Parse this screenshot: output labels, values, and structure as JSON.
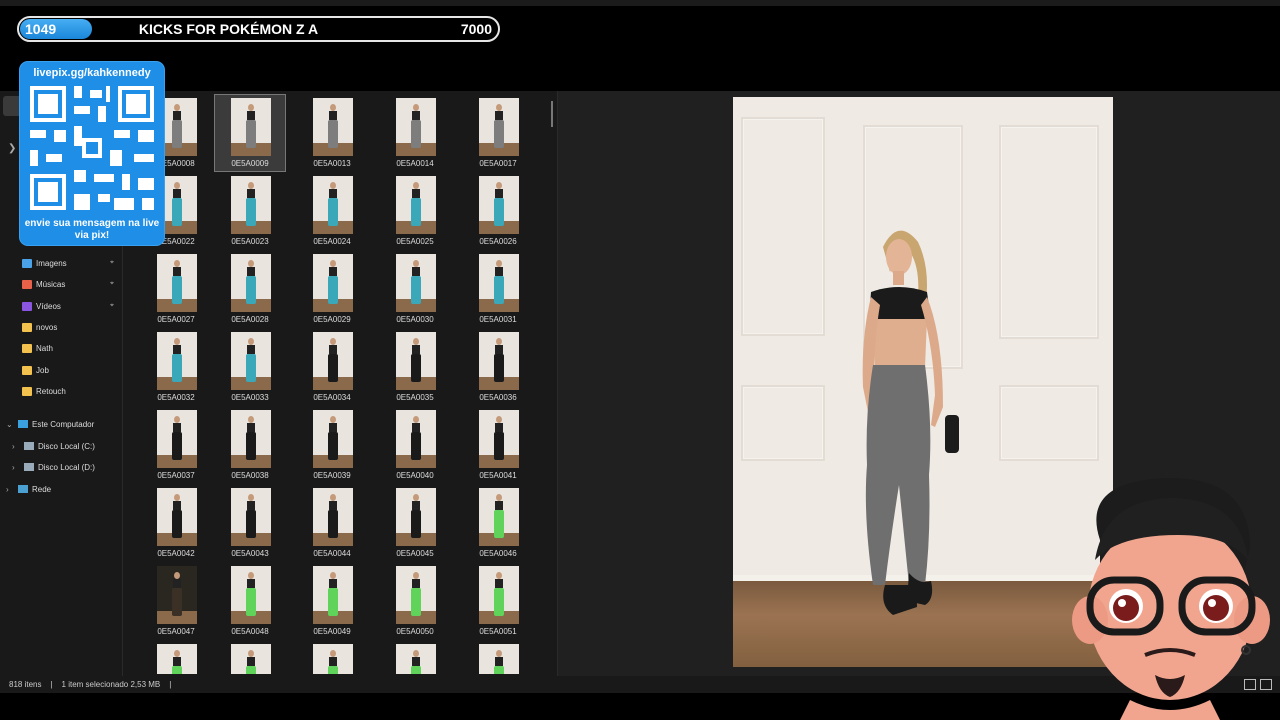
{
  "goal": {
    "current": "1049",
    "title": "KICKS FOR POKÉMON Z A",
    "target": "7000",
    "progress": 0.15
  },
  "qr": {
    "top_text": "livepix.gg/kahkennedy",
    "bottom_text": "envie sua mensagem na live via pix!"
  },
  "sidebar": {
    "items": [
      {
        "label": "Imagens",
        "icon": "images-icon",
        "pinned": true,
        "color": "#4aa3e8"
      },
      {
        "label": "Músicas",
        "icon": "music-icon",
        "pinned": true,
        "color": "#e8624a"
      },
      {
        "label": "Vídeos",
        "icon": "videos-icon",
        "pinned": true,
        "color": "#8a55e0"
      },
      {
        "label": "novos",
        "icon": "folder-icon",
        "pinned": false,
        "color": "#f2c14e"
      },
      {
        "label": "Nath",
        "icon": "folder-icon",
        "pinned": false,
        "color": "#f2c14e"
      },
      {
        "label": "Job",
        "icon": "folder-icon",
        "pinned": false,
        "color": "#f2c14e"
      },
      {
        "label": "Retouch",
        "icon": "folder-icon",
        "pinned": false,
        "color": "#f2c14e"
      }
    ],
    "tree": [
      {
        "label": "Este Computador",
        "icon": "computer-icon",
        "expanded": true
      },
      {
        "label": "Disco Local (C:)",
        "icon": "drive-icon",
        "expanded": false
      },
      {
        "label": "Disco Local (D:)",
        "icon": "drive-icon",
        "expanded": false
      },
      {
        "label": "Rede",
        "icon": "network-icon",
        "expanded": false
      }
    ]
  },
  "files": [
    {
      "name": "0E5A0008",
      "pants": "gray"
    },
    {
      "name": "0E5A0009",
      "pants": "gray",
      "selected": true
    },
    {
      "name": "0E5A0013",
      "pants": "gray"
    },
    {
      "name": "0E5A0014",
      "pants": "gray"
    },
    {
      "name": "0E5A0017",
      "pants": "gray"
    },
    {
      "name": "0E5A0022",
      "pants": "teal"
    },
    {
      "name": "0E5A0023",
      "pants": "teal"
    },
    {
      "name": "0E5A0024",
      "pants": "teal"
    },
    {
      "name": "0E5A0025",
      "pants": "teal"
    },
    {
      "name": "0E5A0026",
      "pants": "teal"
    },
    {
      "name": "0E5A0027",
      "pants": "teal"
    },
    {
      "name": "0E5A0028",
      "pants": "teal"
    },
    {
      "name": "0E5A0029",
      "pants": "teal"
    },
    {
      "name": "0E5A0030",
      "pants": "teal"
    },
    {
      "name": "0E5A0031",
      "pants": "teal"
    },
    {
      "name": "0E5A0032",
      "pants": "teal"
    },
    {
      "name": "0E5A0033",
      "pants": "teal"
    },
    {
      "name": "0E5A0034",
      "pants": "black"
    },
    {
      "name": "0E5A0035",
      "pants": "black"
    },
    {
      "name": "0E5A0036",
      "pants": "black"
    },
    {
      "name": "0E5A0037",
      "pants": "black"
    },
    {
      "name": "0E5A0038",
      "pants": "black"
    },
    {
      "name": "0E5A0039",
      "pants": "black"
    },
    {
      "name": "0E5A0040",
      "pants": "black"
    },
    {
      "name": "0E5A0041",
      "pants": "black"
    },
    {
      "name": "0E5A0042",
      "pants": "black"
    },
    {
      "name": "0E5A0043",
      "pants": "black"
    },
    {
      "name": "0E5A0044",
      "pants": "black"
    },
    {
      "name": "0E5A0045",
      "pants": "black"
    },
    {
      "name": "0E5A0046",
      "pants": "green"
    },
    {
      "name": "0E5A0047",
      "pants": "dark"
    },
    {
      "name": "0E5A0048",
      "pants": "green"
    },
    {
      "name": "0E5A0049",
      "pants": "green"
    },
    {
      "name": "0E5A0050",
      "pants": "green"
    },
    {
      "name": "0E5A0051",
      "pants": "green"
    },
    {
      "name": "",
      "pants": "green"
    },
    {
      "name": "",
      "pants": "green"
    },
    {
      "name": "",
      "pants": "green"
    },
    {
      "name": "",
      "pants": "green"
    },
    {
      "name": "",
      "pants": "green"
    }
  ],
  "status": {
    "count": "818 itens",
    "selection": "1 item selecionado  2,53 MB"
  },
  "colors": {
    "accent": "#1e8ee6",
    "teal": "#3aa8b8",
    "gray": "#7d7d7d",
    "black": "#1a1a1a",
    "green": "#5fd35a"
  }
}
